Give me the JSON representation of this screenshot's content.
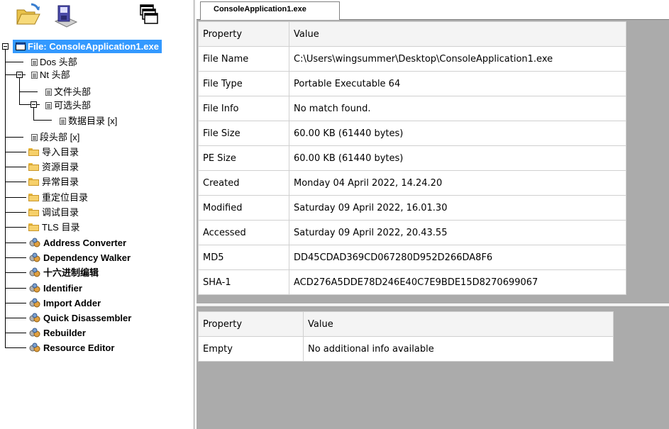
{
  "toolbar": {
    "buttons": [
      {
        "icon": "open-file-icon"
      },
      {
        "icon": "save-icon"
      },
      {
        "icon": "windows-icon"
      }
    ]
  },
  "tree": {
    "root_label": "File: ConsoleApplication1.exe",
    "items": [
      {
        "label": "Dos 头部",
        "icon": "doc-icon"
      },
      {
        "label": "Nt 头部",
        "icon": "doc-icon"
      },
      {
        "label": "文件头部",
        "icon": "doc-icon"
      },
      {
        "label": "可选头部",
        "icon": "doc-icon"
      },
      {
        "label": "数据目录 [x]",
        "icon": "doc-icon"
      },
      {
        "label": "段头部 [x]",
        "icon": "doc-icon"
      },
      {
        "label": "导入目录",
        "icon": "folder-icon"
      },
      {
        "label": "资源目录",
        "icon": "folder-icon"
      },
      {
        "label": "异常目录",
        "icon": "folder-icon"
      },
      {
        "label": "重定位目录",
        "icon": "folder-icon"
      },
      {
        "label": "调试目录",
        "icon": "folder-icon"
      },
      {
        "label": "TLS 目录",
        "icon": "folder-icon"
      },
      {
        "label": "Address Converter",
        "icon": "tool-icon"
      },
      {
        "label": "Dependency Walker",
        "icon": "tool-icon"
      },
      {
        "label": "十六进制编辑",
        "icon": "tool-icon"
      },
      {
        "label": "Identifier",
        "icon": "tool-icon"
      },
      {
        "label": "Import Adder",
        "icon": "tool-icon"
      },
      {
        "label": "Quick Disassembler",
        "icon": "tool-icon"
      },
      {
        "label": "Rebuilder",
        "icon": "tool-icon"
      },
      {
        "label": "Resource Editor",
        "icon": "tool-icon"
      }
    ]
  },
  "tab": {
    "label": "ConsoleApplication1.exe"
  },
  "info_table": {
    "headers": [
      "Property",
      "Value"
    ],
    "rows": [
      [
        "File Name",
        "C:\\Users\\wingsummer\\Desktop\\ConsoleApplication1.exe"
      ],
      [
        "File Type",
        "Portable Executable 64"
      ],
      [
        "File Info",
        "No match found."
      ],
      [
        "File Size",
        "60.00 KB (61440 bytes)"
      ],
      [
        "PE Size",
        "60.00 KB (61440 bytes)"
      ],
      [
        "Created",
        "Monday 04 April 2022, 14.24.20"
      ],
      [
        "Modified",
        "Saturday 09 April 2022, 16.01.30"
      ],
      [
        "Accessed",
        "Saturday 09 April 2022, 20.43.55"
      ],
      [
        "MD5",
        "DD45CDAD369CD067280D952D266DA8F6"
      ],
      [
        "SHA-1",
        "ACD276A5DDE78D246E40C7E9BDE15D8270699067"
      ]
    ]
  },
  "extra_table": {
    "headers": [
      "Property",
      "Value"
    ],
    "rows": [
      [
        "Empty",
        "No additional info available"
      ]
    ]
  },
  "colors": {
    "selection": "#3399ff",
    "pane_background": "#ababab"
  }
}
